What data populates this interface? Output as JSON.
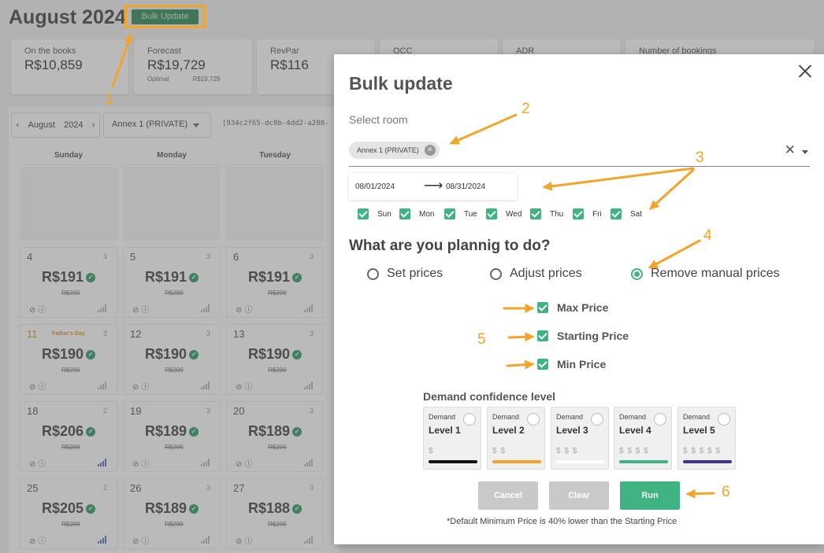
{
  "header": {
    "title": "August 2024",
    "bulk_update_label": "Bulk Update"
  },
  "stats": [
    {
      "label": "On the books",
      "value": "R$10,859"
    },
    {
      "label": "Forecast",
      "value": "R$19,729",
      "sub_label": "Optimal",
      "sub_value": "R$19,729"
    },
    {
      "label": "RevPar",
      "value": "R$116"
    },
    {
      "label": "OCC",
      "value": ""
    },
    {
      "label": "ADR",
      "value": ""
    },
    {
      "label": "Number of bookings",
      "value": ""
    }
  ],
  "calendar": {
    "month": "August",
    "year": "2024",
    "room": "Annex 1 (PRIVATE)",
    "room_id": "[934c2f65-dc0b-4dd2-a208-",
    "weekdays": [
      "Sunday",
      "Monday",
      "Tuesday"
    ],
    "rows": [
      [
        {
          "day": "4",
          "count": "3",
          "price": "R$191",
          "old": "R$200",
          "event": "",
          "bars_color": "gray"
        },
        {
          "day": "5",
          "count": "3",
          "price": "R$191",
          "old": "R$200",
          "event": "",
          "bars_color": "gray"
        },
        {
          "day": "6",
          "count": "3",
          "price": "R$191",
          "old": "R$200",
          "event": "",
          "bars_color": "gray"
        }
      ],
      [
        {
          "day": "11",
          "count": "3",
          "price": "R$190",
          "old": "R$200",
          "event": "Father's Day",
          "bars_color": "gray"
        },
        {
          "day": "12",
          "count": "3",
          "price": "R$190",
          "old": "R$200",
          "event": "",
          "bars_color": "gray"
        },
        {
          "day": "13",
          "count": "3",
          "price": "R$190",
          "old": "R$200",
          "event": "",
          "bars_color": "gray"
        }
      ],
      [
        {
          "day": "18",
          "count": "2",
          "price": "R$206",
          "old": "R$200",
          "event": "",
          "bars_color": "blue"
        },
        {
          "day": "19",
          "count": "3",
          "price": "R$189",
          "old": "R$200",
          "event": "",
          "bars_color": "gray"
        },
        {
          "day": "20",
          "count": "3",
          "price": "R$189",
          "old": "R$200",
          "event": "",
          "bars_color": "gray"
        }
      ],
      [
        {
          "day": "25",
          "count": "2",
          "price": "R$205",
          "old": "R$200",
          "event": "",
          "bars_color": "blue"
        },
        {
          "day": "26",
          "count": "3",
          "price": "R$189",
          "old": "R$200",
          "event": "",
          "bars_color": "gray"
        },
        {
          "day": "27",
          "count": "3",
          "price": "R$188",
          "old": "R$200",
          "event": "",
          "bars_color": "gray"
        }
      ]
    ]
  },
  "modal": {
    "title": "Bulk update",
    "select_room_label": "Select room",
    "room_chip": "Annex 1 (PRIVATE)",
    "date_from": "08/01/2024",
    "date_to": "08/31/2024",
    "weekdays": [
      "Sun",
      "Mon",
      "Tue",
      "Wed",
      "Thu",
      "Fri",
      "Sat"
    ],
    "question": "What are you plannig to do?",
    "actions": [
      {
        "label": "Set prices",
        "selected": false
      },
      {
        "label": "Adjust prices",
        "selected": false
      },
      {
        "label": "Remove manual prices",
        "selected": true
      }
    ],
    "price_options": [
      "Max Price",
      "Starting Price",
      "Min Price"
    ],
    "demand_title": "Demand confidence level",
    "levels": [
      {
        "small": "Demand",
        "name": "Level 1",
        "dollars": "$",
        "color": "#111111"
      },
      {
        "small": "Demand",
        "name": "Level 2",
        "dollars": "$ $",
        "color": "#f2a52a"
      },
      {
        "small": "Demand",
        "name": "Level 3",
        "dollars": "$ $ $",
        "color": "#ffffff"
      },
      {
        "small": "Demand",
        "name": "Level 4",
        "dollars": "$ $ $ $",
        "color": "#3fb482"
      },
      {
        "small": "Demand",
        "name": "Level 5",
        "dollars": "$ $ $ $ $",
        "color": "#3c3596"
      }
    ],
    "buttons": {
      "cancel": "Cancel",
      "clear": "Clear",
      "run": "Run"
    },
    "footnote": "*Default Minimum Price is 40% lower than the Starting Price"
  },
  "annotations": [
    "1",
    "2",
    "3",
    "4",
    "5",
    "6"
  ],
  "colors": {
    "accent": "#3fb482",
    "annotation": "#f2a52a",
    "brand_green": "#2e8b57"
  }
}
